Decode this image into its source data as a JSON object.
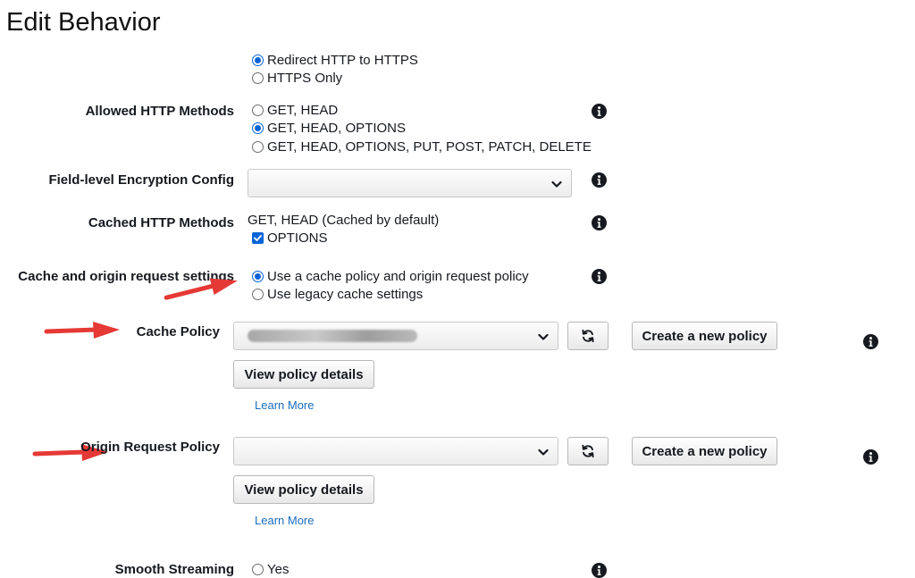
{
  "page": {
    "title": "Edit Behavior"
  },
  "viewer_protocol": {
    "options": [
      {
        "label": "Redirect HTTP to HTTPS",
        "selected": true
      },
      {
        "label": "HTTPS Only",
        "selected": false
      }
    ]
  },
  "allowed_methods": {
    "label": "Allowed HTTP Methods",
    "options": [
      {
        "label": "GET, HEAD",
        "selected": false
      },
      {
        "label": "GET, HEAD, OPTIONS",
        "selected": true
      },
      {
        "label": "GET, HEAD, OPTIONS, PUT, POST, PATCH, DELETE",
        "selected": false
      }
    ]
  },
  "fle_config": {
    "label": "Field-level Encryption Config",
    "value": ""
  },
  "cached_methods": {
    "label": "Cached HTTP Methods",
    "static_text": "GET, HEAD (Cached by default)",
    "options_label": "OPTIONS",
    "options_checked": true
  },
  "cache_settings": {
    "label": "Cache and origin request settings",
    "options": [
      {
        "label": "Use a cache policy and origin request policy",
        "selected": true
      },
      {
        "label": "Use legacy cache settings",
        "selected": false
      }
    ]
  },
  "cache_policy": {
    "label": "Cache Policy",
    "create_label": "Create a new policy",
    "view_label": "View policy details",
    "learn_more": "Learn More"
  },
  "origin_policy": {
    "label": "Origin Request Policy",
    "value": "",
    "create_label": "Create a new policy",
    "view_label": "View policy details",
    "learn_more": "Learn More"
  },
  "smooth_streaming": {
    "label": "Smooth Streaming",
    "options": [
      {
        "label": "Yes",
        "selected": false
      }
    ]
  },
  "colors": {
    "accent": "#0a64d6",
    "link": "#1a6dbd",
    "annotation_arrow": "#e53935"
  }
}
